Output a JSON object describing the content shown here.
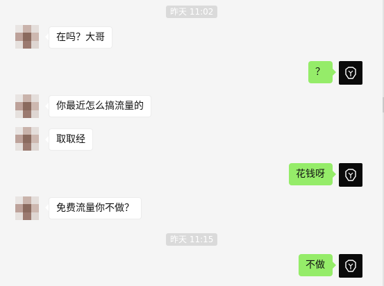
{
  "timestamps": [
    "昨天 11:02",
    "昨天 11:15"
  ],
  "messages": [
    {
      "from": "contact",
      "text": "在吗？大哥"
    },
    {
      "from": "me",
      "text": "？"
    },
    {
      "from": "contact",
      "text": "你最近怎么搞流量的"
    },
    {
      "from": "contact",
      "text": "取取经"
    },
    {
      "from": "me",
      "text": "花钱呀"
    },
    {
      "from": "contact",
      "text": "免费流量你不做？"
    },
    {
      "from": "me",
      "text": "不做"
    }
  ],
  "avatars": {
    "contact": "pixelated-photo-avatar",
    "me": "logo-avatar-icon"
  },
  "colors": {
    "background": "#f5f5f5",
    "outgoing_bubble": "#95ec69",
    "incoming_bubble": "#ffffff",
    "timestamp_bg": "#dadada"
  }
}
